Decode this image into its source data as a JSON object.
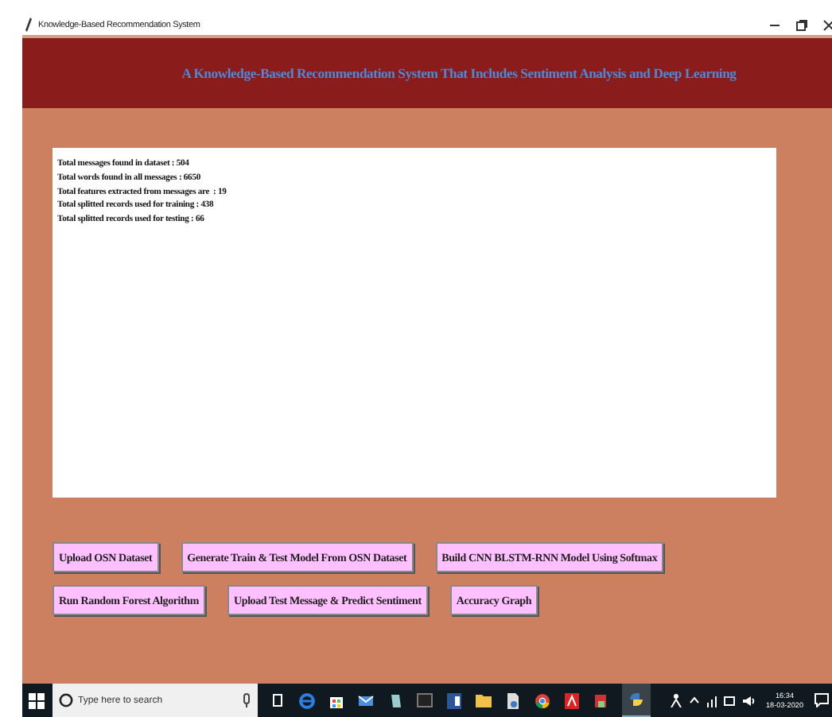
{
  "window": {
    "title": "Knowledge-Based Recommendation System"
  },
  "banner": {
    "title": "A Knowledge-Based Recommendation System That Includes Sentiment Analysis and Deep Learning"
  },
  "output_lines": [
    "Total messages found in dataset : 504",
    "Total words found in all messages : 6650",
    "Total features extracted from messages are  : 19",
    "Total splitted records used for training : 438",
    "Total splitted records used for testing : 66"
  ],
  "button_rows": [
    [
      "Upload OSN Dataset",
      "Generate Train & Test Model From OSN Dataset",
      "Build CNN BLSTM-RNN Model Using Softmax"
    ],
    [
      "Run Random Forest Algorithm",
      "Upload Test Message & Predict Sentiment",
      "Accuracy Graph"
    ]
  ],
  "taskbar": {
    "search": {
      "placeholder": "Type here to search"
    },
    "time": "16:34",
    "date": "18-03-2020"
  }
}
